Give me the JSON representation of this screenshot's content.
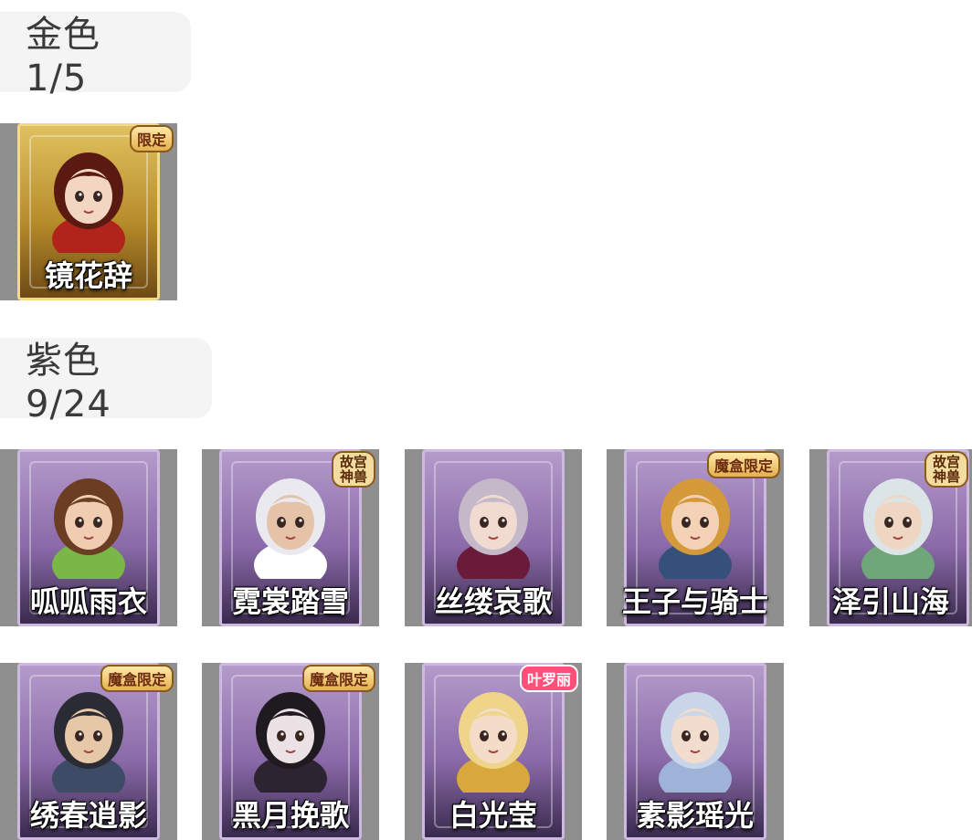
{
  "sections": {
    "gold": {
      "label": "金色 1/5"
    },
    "purple": {
      "label": "紫色 9/24"
    }
  },
  "cards": [
    {
      "name": "镜花辞",
      "tier": "gold",
      "badge": "限定",
      "hair": "#5a1a12",
      "hood": "#b0241c",
      "skin": "#f2d6c2"
    },
    {
      "name": "呱呱雨衣",
      "tier": "purple",
      "badge": "",
      "hair": "#6b3d22",
      "hood": "#7ab648",
      "skin": "#f0cdb0"
    },
    {
      "name": "霓裳踏雪",
      "tier": "purple",
      "badge": "故宫神兽",
      "hair": "#e9e9ef",
      "hood": "#ffffff",
      "skin": "#e4c3a8"
    },
    {
      "name": "丝缕哀歌",
      "tier": "purple",
      "badge": "",
      "hair": "#c5b8c9",
      "hood": "#6a1b3a",
      "skin": "#f1dad0"
    },
    {
      "name": "王子与骑士",
      "tier": "purple",
      "badge": "魔盒限定",
      "hair": "#d49a3a",
      "hood": "#35507a",
      "skin": "#f3d2b5"
    },
    {
      "name": "泽引山海",
      "tier": "purple",
      "badge": "故宫神兽",
      "hair": "#dbe4e6",
      "hood": "#6fa67a",
      "skin": "#efd6c2"
    },
    {
      "name": "绣春逍影",
      "tier": "purple",
      "badge": "魔盒限定",
      "hair": "#2b2b33",
      "hood": "#3d4b66",
      "skin": "#e6c7a8"
    },
    {
      "name": "黑月挽歌",
      "tier": "purple",
      "badge": "魔盒限定",
      "hair": "#1e1a1f",
      "hood": "#2c2430",
      "skin": "#ebe2e6"
    },
    {
      "name": "白光莹",
      "tier": "purple",
      "badge": "叶罗丽",
      "hair": "#efd58a",
      "hood": "#d8a83c",
      "skin": "#f4dcc8"
    },
    {
      "name": "素影瑶光",
      "tier": "purple",
      "badge": "",
      "hair": "#c9d6ea",
      "hood": "#9fb2d8",
      "skin": "#f2dccd"
    }
  ]
}
